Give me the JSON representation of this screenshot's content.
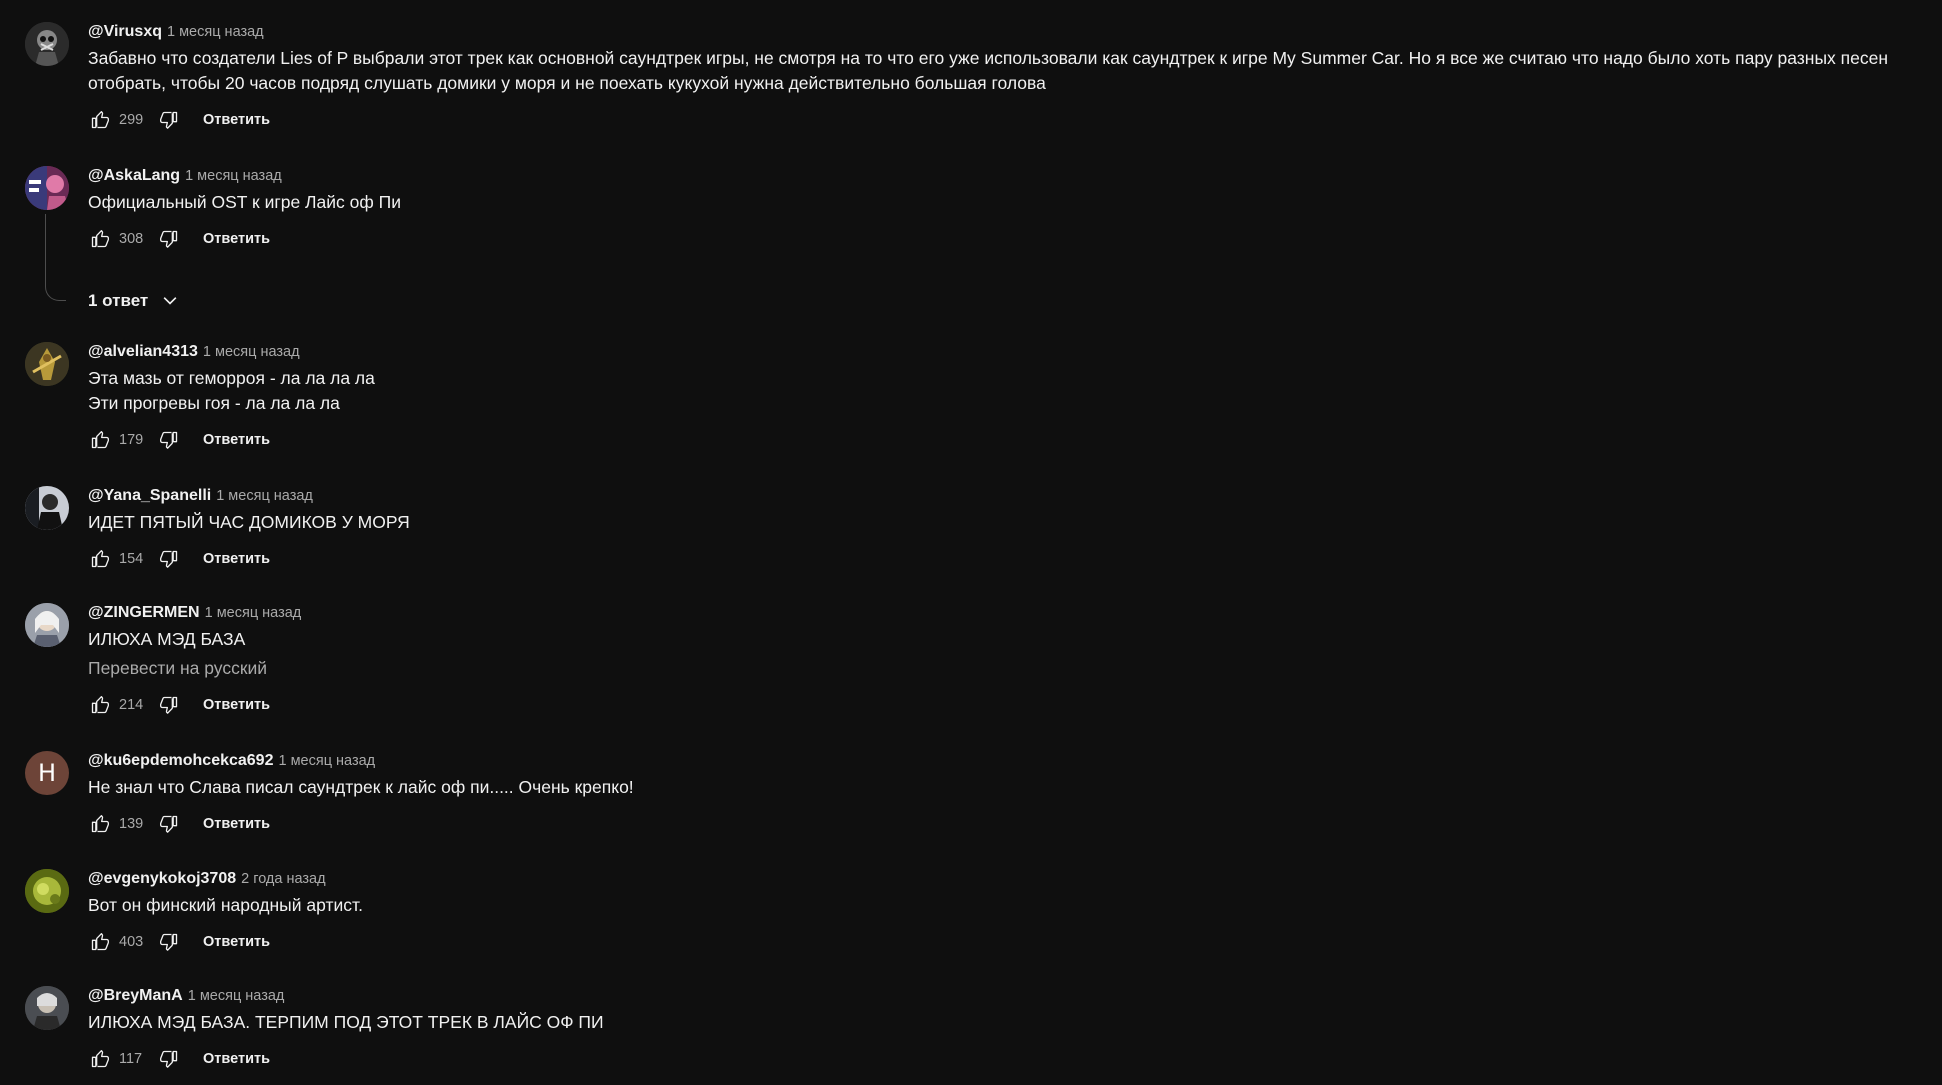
{
  "ui": {
    "reply_label": "Ответить",
    "translate_label": "Перевести на русский"
  },
  "comments": [
    {
      "author": "@Virusxq",
      "time": "1 месяц назад",
      "text": "Забавно что создатели Lies of P выбрали этот трек как основной саундтрек игры, не смотря на то что его уже использовали как саундтрек к игре My Summer Car. Но я все же считаю что надо было хоть пару разных песен отобрать, чтобы 20 часов подряд слушать домики у моря и не поехать кукухой нужна действительно большая голова",
      "likes": "299",
      "avatar_color": "#3a3a3a"
    },
    {
      "author": "@AskaLang",
      "time": "1 месяц назад",
      "text": "Официальный OST к игре Лайс оф Пи",
      "likes": "308",
      "avatar_color": "#8a3a6a",
      "replies_label": "1 ответ"
    },
    {
      "author": "@alvelian4313",
      "time": "1 месяц назад",
      "text": "Эта мазь от геморроя - ла ла ла ла\nЭти прогревы гоя - ла ла ла ла",
      "likes": "179",
      "avatar_color": "#4a4a2a"
    },
    {
      "author": "@Yana_Spanelli",
      "time": "1 месяц назад",
      "text": "ИДЕТ ПЯТЫЙ ЧАС ДОМИКОВ У МОРЯ",
      "likes": "154",
      "avatar_color": "#2a2f38"
    },
    {
      "author": "@ZINGERMEN",
      "time": "1 месяц назад",
      "text": "ИЛЮХА МЭД БАЗА",
      "likes": "214",
      "avatar_color": "#8a8d96"
    },
    {
      "author": "@ku6epdemohcekca692",
      "time": "1 месяц назад",
      "text": "Не знал что Слава писал саундтрек к лайс оф пи..... Очень крепко!",
      "likes": "139",
      "avatar_color": "#6d4438",
      "avatar_letter": "Н"
    },
    {
      "author": "@evgenykokoj3708",
      "time": "2 года назад",
      "text": "Вот он финский народный артист.",
      "likes": "403",
      "avatar_color": "#7a8a1a"
    },
    {
      "author": "@BreyManA",
      "time": "1 месяц назад",
      "text": "ИЛЮХА МЭД БАЗА. ТЕРПИМ ПОД ЭТОТ ТРЕК В ЛАЙС ОФ ПИ",
      "likes": "117",
      "avatar_color": "#5a5a5a"
    }
  ]
}
